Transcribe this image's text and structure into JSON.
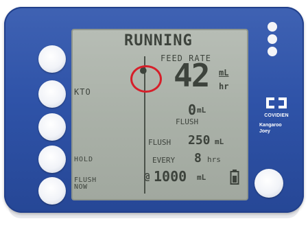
{
  "status": {
    "title": "RUNNING"
  },
  "softkeys": {
    "left": [
      "KTO",
      "HOLD",
      "FLUSH NOW"
    ]
  },
  "display": {
    "feed_rate_label": "FEED RATE",
    "feed_rate_value": "42",
    "feed_rate_unit_top": "mL",
    "feed_rate_unit_bottom": "hr",
    "flush_total_value": "0",
    "flush_total_unit": "mL",
    "flush_total_label": "FLUSH",
    "flush_label": "FLUSH",
    "flush_value": "250",
    "flush_unit": "mL",
    "every_label": "EVERY",
    "every_value": "8",
    "every_unit": "hrs",
    "dose_prefix": "@",
    "dose_value": "1000",
    "dose_unit": "mL"
  },
  "brand": {
    "name": "COVIDIEN",
    "product_line_1": "Kangaroo",
    "product_line_2": "Joey"
  },
  "icons": {
    "drop": "droplet-icon",
    "battery": "battery-icon",
    "logo": "covidien-logo-icon"
  },
  "colors": {
    "body": "#2f53a8",
    "lcd": "#aab1a8",
    "highlight": "#d61f2a"
  }
}
